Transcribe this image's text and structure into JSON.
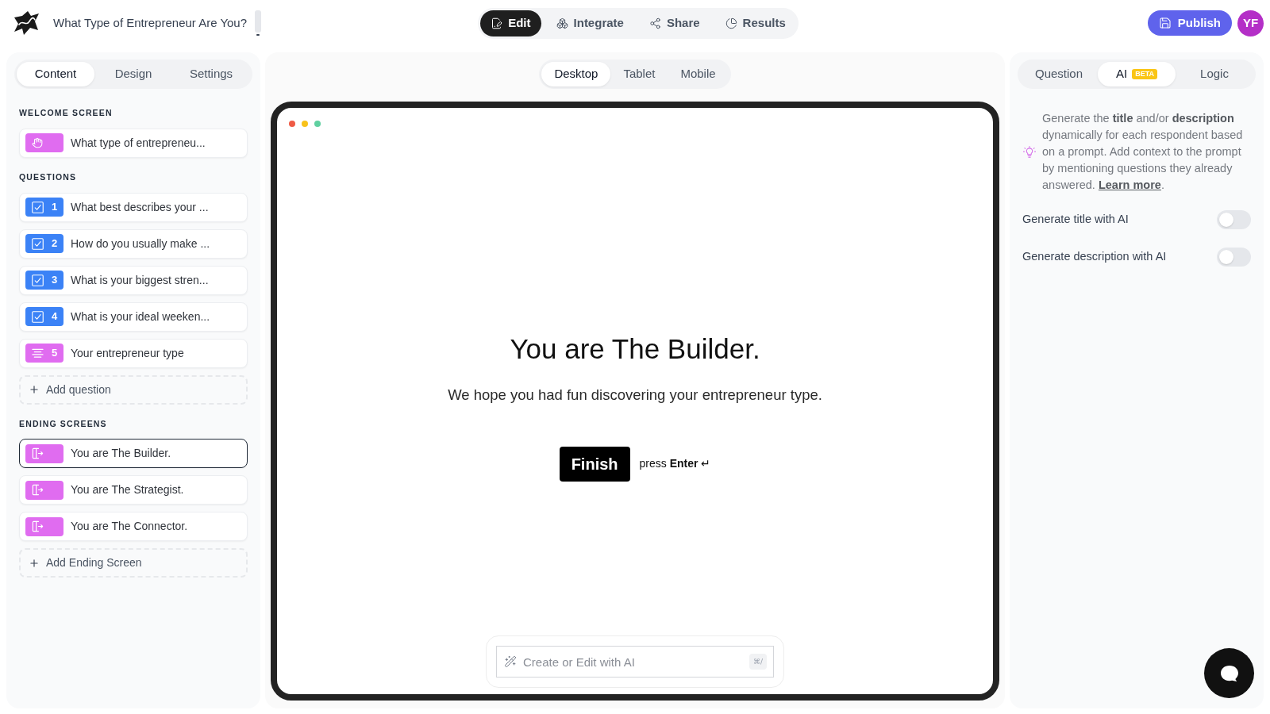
{
  "header": {
    "form_title": "What Type of Entrepreneur Are You?",
    "nav_tabs": [
      {
        "label": "Edit",
        "selected": true
      },
      {
        "label": "Integrate",
        "selected": false
      },
      {
        "label": "Share",
        "selected": false
      },
      {
        "label": "Results",
        "selected": false
      }
    ],
    "publish_button": "Publish",
    "avatar_initials": "YF"
  },
  "left_panel": {
    "tabs": [
      {
        "label": "Content",
        "selected": true
      },
      {
        "label": "Design",
        "selected": false
      },
      {
        "label": "Settings",
        "selected": false
      }
    ],
    "sections": [
      {
        "heading": "WELCOME SCREEN",
        "items": [
          {
            "kind": "welcome",
            "title": "What type of entrepreneu...",
            "selected": false
          }
        ]
      },
      {
        "heading": "QUESTIONS",
        "items": [
          {
            "kind": "multiple_choice",
            "number": "1",
            "title": "What best describes your ...",
            "selected": false
          },
          {
            "kind": "multiple_choice",
            "number": "2",
            "title": "How do you usually make ...",
            "selected": false
          },
          {
            "kind": "multiple_choice",
            "number": "3",
            "title": "What is your biggest stren...",
            "selected": false
          },
          {
            "kind": "multiple_choice",
            "number": "4",
            "title": "What is your ideal weeken...",
            "selected": false
          },
          {
            "kind": "statement",
            "number": "5",
            "title": "Your entrepreneur type",
            "selected": false
          }
        ],
        "add_button": "Add question"
      },
      {
        "heading": "ENDING SCREENS",
        "items": [
          {
            "kind": "ending",
            "title": "You are The Builder.",
            "selected": true
          },
          {
            "kind": "ending",
            "title": "You are The Strategist.",
            "selected": false
          },
          {
            "kind": "ending",
            "title": "You are The Connector.",
            "selected": false
          }
        ],
        "add_button": "Add Ending Screen"
      }
    ]
  },
  "preview": {
    "device_tabs": [
      {
        "label": "Desktop",
        "selected": true
      },
      {
        "label": "Tablet",
        "selected": false
      },
      {
        "label": "Mobile",
        "selected": false
      }
    ],
    "title": "You are The Builder.",
    "description": "We hope you had fun discovering your entrepreneur type.",
    "button": "Finish",
    "key_hint": "press **Enter** ↵",
    "ai_prompt": {
      "placeholder": "Create or Edit with AI",
      "shortcut": "⌘/"
    }
  },
  "right_panel": {
    "tabs": [
      {
        "label": "Question",
        "selected": false
      },
      {
        "label": "AI",
        "badge": "BETA",
        "selected": true
      },
      {
        "label": "Logic",
        "selected": false
      }
    ],
    "ai_info": {
      "text": "Generate the **title** and/or **description** dynamically for each respondent based on a prompt. Add context to the prompt by mentioning questions they already answered.",
      "link": "Learn more",
      "trailing": "."
    },
    "toggles": [
      {
        "label": "Generate title with AI",
        "on": false
      },
      {
        "label": "Generate description with AI",
        "on": false
      }
    ]
  }
}
